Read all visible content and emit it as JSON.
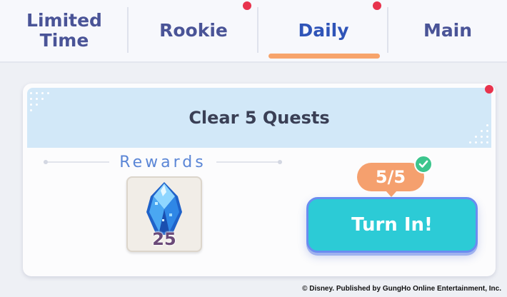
{
  "tabs": [
    {
      "label_line1": "Limited",
      "label_line2": "Time",
      "active": false,
      "notification": false
    },
    {
      "label": "Rookie",
      "active": false,
      "notification": true
    },
    {
      "label": "Daily",
      "active": true,
      "notification": true
    },
    {
      "label": "Main",
      "active": false,
      "notification": false
    }
  ],
  "quest": {
    "title": "Clear 5 Quests",
    "rewards_label": "Rewards",
    "reward": {
      "icon": "blue-crystal-icon",
      "quantity": "25"
    },
    "progress": "5/5",
    "progress_complete": true,
    "button_label": "Turn In!",
    "notification": true
  },
  "copyright": "© Disney.  Published by GungHo Online Entertainment, Inc.",
  "colors": {
    "active_tab": "#2f54b8",
    "tab_text": "#4a5497",
    "active_underline": "#f7a46b",
    "notification_dot": "#e8334d",
    "button": "#2ccbd6",
    "progress_bubble": "#f5a06e",
    "check": "#3cc58d"
  }
}
